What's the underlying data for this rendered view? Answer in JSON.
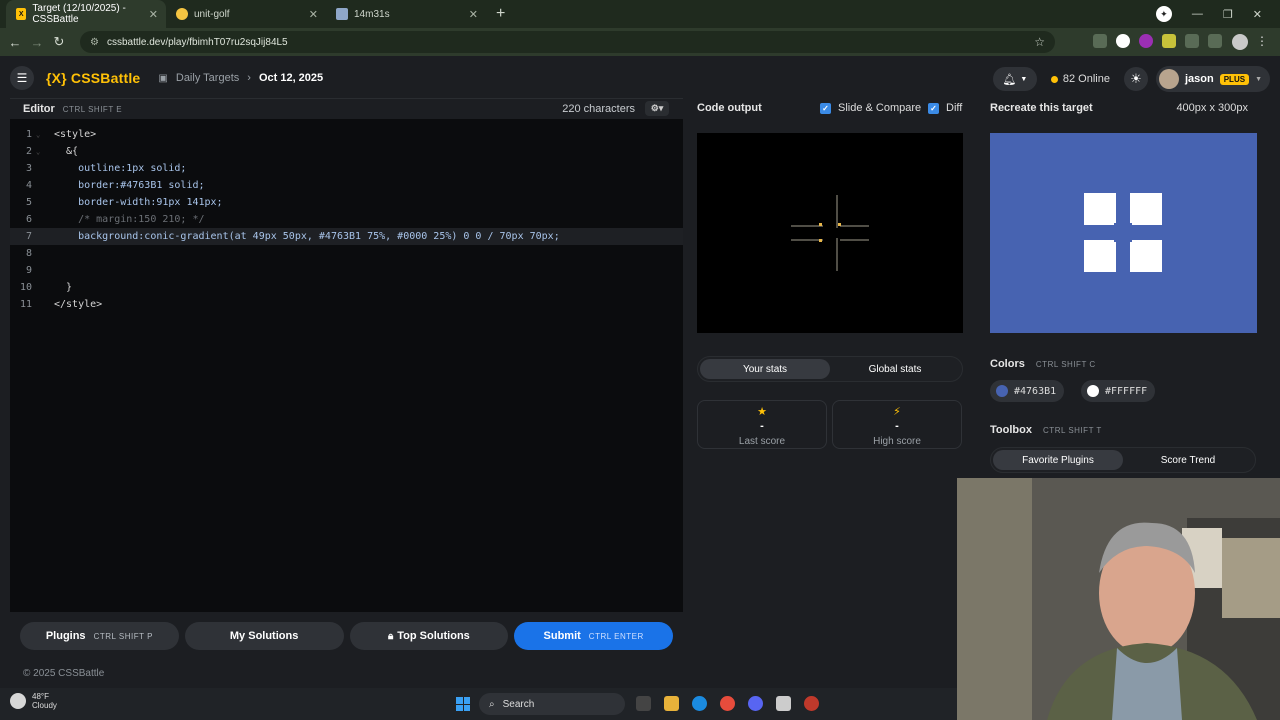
{
  "browser": {
    "tabs": [
      {
        "title": "Target (12/10/2025) - CSSBattle",
        "favicon": "cssbattle-icon",
        "active": true
      },
      {
        "title": "unit-golf",
        "favicon": "golf-icon",
        "active": false
      },
      {
        "title": "14m31s",
        "favicon": "timer-icon",
        "active": false
      }
    ],
    "url": "cssbattle.dev/play/fbimhT07ru2sqJij84L5"
  },
  "app": {
    "logo": "{X} CSSBattle",
    "breadcrumb": {
      "parent": "Daily Targets",
      "current": "Oct 12, 2025"
    },
    "online": "82 Online",
    "user": {
      "name": "jason",
      "badge": "PLUS"
    }
  },
  "editor": {
    "title": "Editor",
    "shortcut": "CTRL  SHIFT  E",
    "characters": "220 characters",
    "lines": [
      {
        "n": "1",
        "text": "<style>"
      },
      {
        "n": "2",
        "text": "  &{"
      },
      {
        "n": "3",
        "text": "    outline:1px solid;"
      },
      {
        "n": "4",
        "text": "    border:#4763B1 solid;"
      },
      {
        "n": "5",
        "text": "    border-width:91px 141px;"
      },
      {
        "n": "6",
        "text": "    /* margin:150 210; */"
      },
      {
        "n": "7",
        "text": "    background:conic-gradient(at 49px 50px, #4763B1 75%, #0000 25%) 0 0 / 70px 70px;"
      },
      {
        "n": "8",
        "text": ""
      },
      {
        "n": "9",
        "text": ""
      },
      {
        "n": "10",
        "text": "  }"
      },
      {
        "n": "11",
        "text": "</style>"
      }
    ],
    "footer": {
      "plugins": "Plugins",
      "plugins_kbd": "CTRL  SHIFT  P",
      "my_solutions": "My Solutions",
      "top_solutions": "Top Solutions",
      "submit": "Submit",
      "submit_kbd": "CTRL  ENTER"
    },
    "copyright": "© 2025 CSSBattle"
  },
  "output": {
    "title": "Code output",
    "slide_compare": "Slide & Compare",
    "diff": "Diff",
    "stats_tabs": [
      "Your stats",
      "Global stats"
    ],
    "last_score": {
      "value": "-",
      "label": "Last score"
    },
    "high_score": {
      "value": "-",
      "label": "High score"
    }
  },
  "target": {
    "title": "Recreate this target",
    "size": "400px x 300px",
    "colors_title": "Colors",
    "colors_kbd": "CTRL  SHIFT  C",
    "colors": [
      "#4763B1",
      "#FFFFFF"
    ],
    "toolbox_title": "Toolbox",
    "toolbox_kbd": "CTRL  SHIFT  T",
    "toolbox_tabs": [
      "Favorite Plugins",
      "Score Trend"
    ]
  },
  "taskbar": {
    "weather_temp": "48°F",
    "weather_desc": "Cloudy",
    "search": "Search"
  },
  "colors": {
    "accent": "#ffc107",
    "target_bg": "#4763b1",
    "submit": "#1a73e8"
  }
}
